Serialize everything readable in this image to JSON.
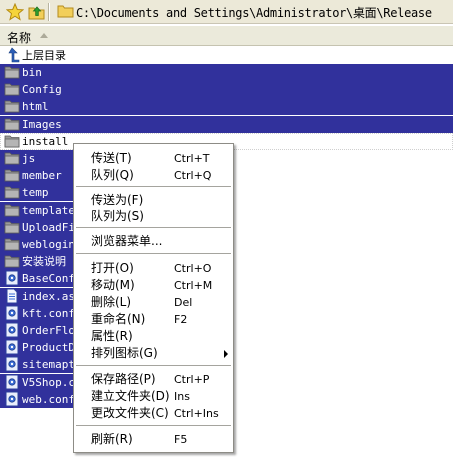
{
  "toolbar": {
    "star_icon": "star-icon",
    "up_icon": "up-folder-icon",
    "address": "C:\\Documents and Settings\\Administrator\\桌面\\Release"
  },
  "header": {
    "name_column": "名称"
  },
  "parent_dir": "上层目录",
  "files": [
    {
      "name": "bin",
      "icon": "folder",
      "selected": true
    },
    {
      "name": "Config",
      "icon": "folder",
      "selected": true
    },
    {
      "name": "html",
      "icon": "folder",
      "selected": true
    },
    {
      "name": "Images",
      "icon": "folder",
      "selected": true
    },
    {
      "name": "install",
      "icon": "folder",
      "selected": false,
      "focused": true
    },
    {
      "name": "js",
      "icon": "folder",
      "selected": true
    },
    {
      "name": "member",
      "icon": "folder",
      "selected": true
    },
    {
      "name": "temp",
      "icon": "folder",
      "selected": true
    },
    {
      "name": "template",
      "icon": "folder",
      "selected": true
    },
    {
      "name": "UploadFi",
      "icon": "folder",
      "selected": true
    },
    {
      "name": "weblogin",
      "icon": "folder",
      "selected": true
    },
    {
      "name": "安装说明",
      "icon": "folder",
      "selected": true
    },
    {
      "name": "BaseConf",
      "icon": "config",
      "selected": true
    },
    {
      "name": "index.as",
      "icon": "doc",
      "selected": true
    },
    {
      "name": "kft.conf",
      "icon": "config",
      "selected": true
    },
    {
      "name": "OrderFlo",
      "icon": "config",
      "selected": true
    },
    {
      "name": "ProductD",
      "icon": "config",
      "selected": true
    },
    {
      "name": "sitemapt",
      "icon": "config",
      "selected": true
    },
    {
      "name": "V5Shop.c",
      "icon": "config",
      "selected": true
    },
    {
      "name": "web.conf",
      "icon": "config",
      "selected": true
    }
  ],
  "menu": {
    "items": [
      {
        "label": "传送(T)",
        "shortcut": "Ctrl+T"
      },
      {
        "label": "队列(Q)",
        "shortcut": "Ctrl+Q"
      },
      {
        "label": "传送为(F)",
        "shortcut": ""
      },
      {
        "label": "队列为(S)",
        "shortcut": ""
      },
      {
        "label": "浏览器菜单...",
        "shortcut": ""
      },
      {
        "label": "打开(O)",
        "shortcut": "Ctrl+O"
      },
      {
        "label": "移动(M)",
        "shortcut": "Ctrl+M"
      },
      {
        "label": "删除(L)",
        "shortcut": "Del"
      },
      {
        "label": "重命名(N)",
        "shortcut": "F2"
      },
      {
        "label": "属性(R)",
        "shortcut": ""
      },
      {
        "label": "排列图标(G)",
        "shortcut": ""
      },
      {
        "label": "保存路径(P)",
        "shortcut": "Ctrl+P"
      },
      {
        "label": "建立文件夹(D)",
        "shortcut": "Ins"
      },
      {
        "label": "更改文件夹(C)",
        "shortcut": "Ctrl+Ins"
      },
      {
        "label": "刷新(R)",
        "shortcut": "F5"
      }
    ]
  },
  "colors": {
    "selection": "#31319c",
    "toolbar": "#ece9d8",
    "folder": "#8c8c8c"
  }
}
